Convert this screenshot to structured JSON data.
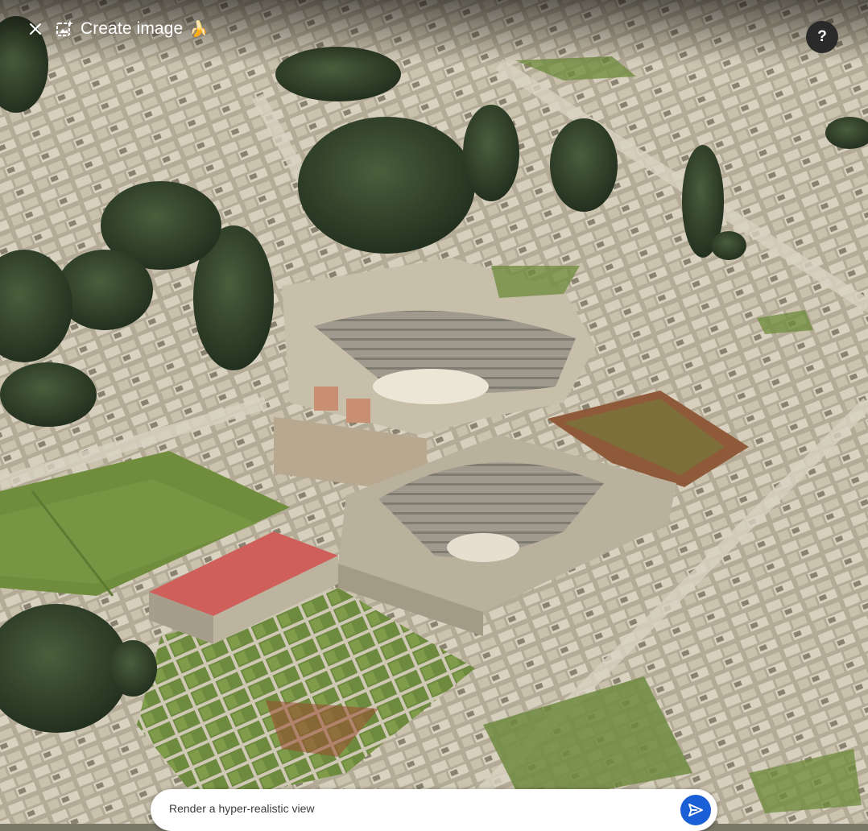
{
  "header": {
    "title": "Create image",
    "title_emoji": "🍌",
    "close_icon": "close-icon",
    "create_icon": "image-spark-icon",
    "help_label": "?"
  },
  "prompt": {
    "value": "Render a hyper-realistic view",
    "send_icon": "send-icon"
  },
  "colors": {
    "send_button": "#1a5fd6",
    "help_button": "#2a2a2a"
  }
}
